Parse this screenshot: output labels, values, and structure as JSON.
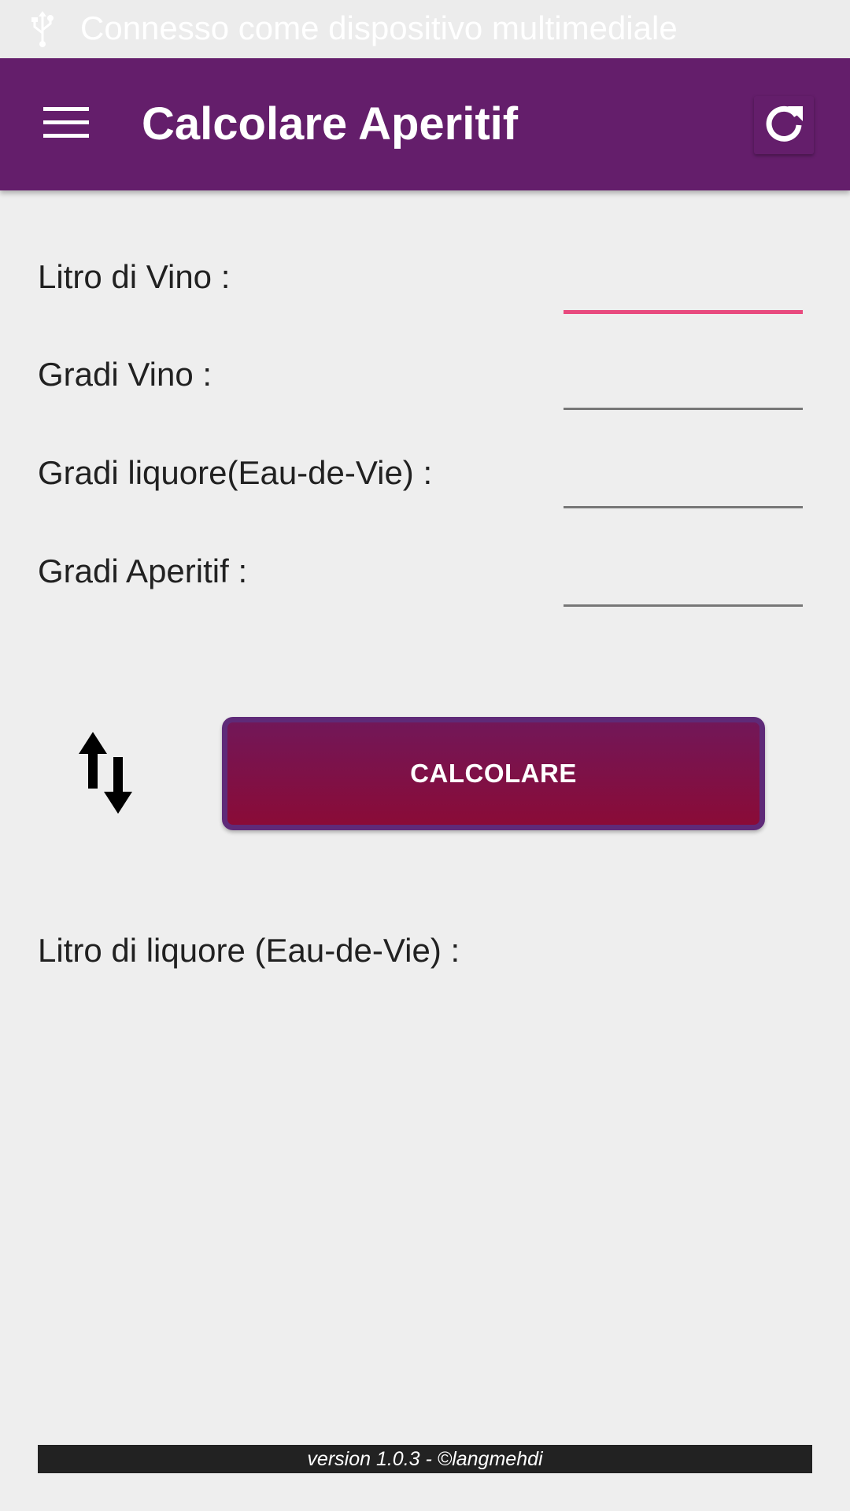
{
  "status_bar": {
    "notification_text": "Connesso come dispositivo multimediale",
    "icon": "usb-icon"
  },
  "app_bar": {
    "title": "Calcolare Aperitif",
    "menu_icon": "hamburger-menu-icon",
    "refresh_icon": "refresh-icon",
    "background_color": "#641e6b"
  },
  "form": {
    "fields": [
      {
        "label": "Litro di Vino :",
        "value": "",
        "focused": true
      },
      {
        "label": "Gradi Vino :",
        "value": "",
        "focused": false
      },
      {
        "label": "Gradi liquore(Eau-de-Vie) :",
        "value": "",
        "focused": false
      },
      {
        "label": "Gradi Aperitif :",
        "value": "",
        "focused": false
      }
    ],
    "focus_color": "#e84a7e"
  },
  "swap_icon": "swap-vertical-icon",
  "calculate_button": {
    "label": "CALCOLARE",
    "color": "#8a0b37"
  },
  "result": {
    "label": "Litro di liquore (Eau-de-Vie) :",
    "value": ""
  },
  "footer": {
    "text": "version 1.0.3 - ©langmehdi"
  }
}
